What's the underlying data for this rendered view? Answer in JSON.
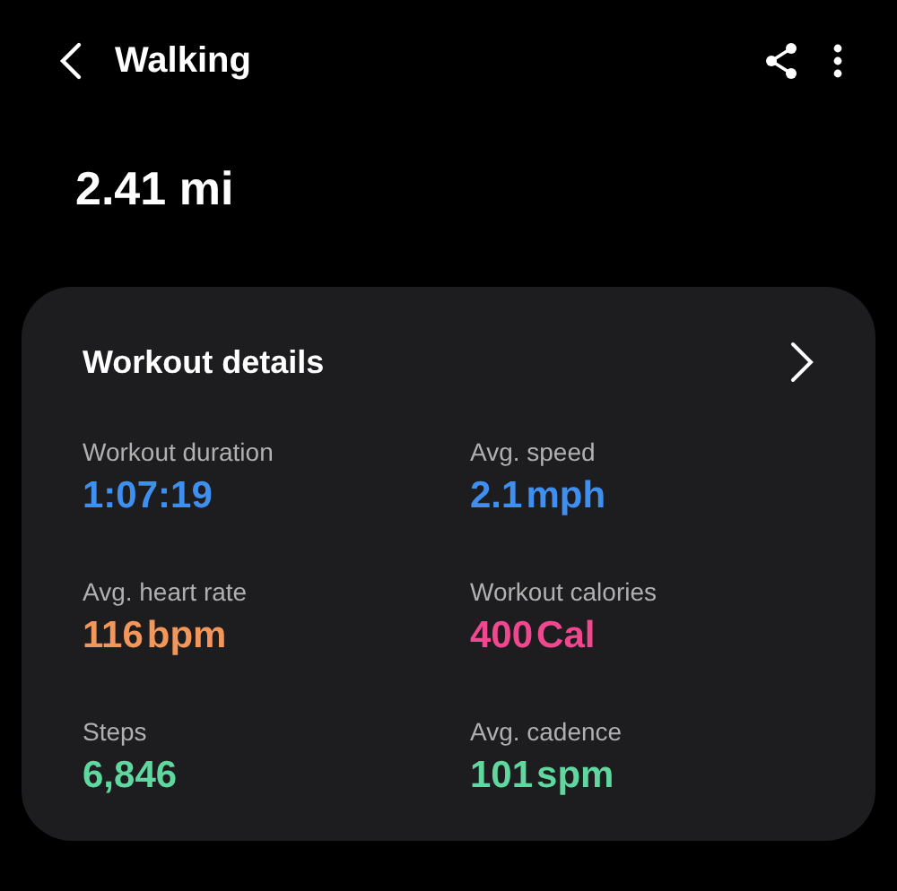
{
  "header": {
    "title": "Walking"
  },
  "distance": "2.41 mi",
  "card": {
    "title": "Workout details",
    "metrics": [
      {
        "label": "Workout duration",
        "value": "1:07:19",
        "color": "#3f8ff0"
      },
      {
        "label": "Avg. speed",
        "value": "2.1",
        "unit": "mph",
        "color": "#3f8ff0"
      },
      {
        "label": "Avg. heart rate",
        "value": "116",
        "unit": "bpm",
        "color": "#f39659"
      },
      {
        "label": "Workout calories",
        "value": "400",
        "unit": "Cal",
        "color": "#f0478f"
      },
      {
        "label": "Steps",
        "value": "6,846",
        "color": "#5fd79f"
      },
      {
        "label": "Avg. cadence",
        "value": "101",
        "unit": "spm",
        "color": "#5fd79f"
      }
    ]
  }
}
